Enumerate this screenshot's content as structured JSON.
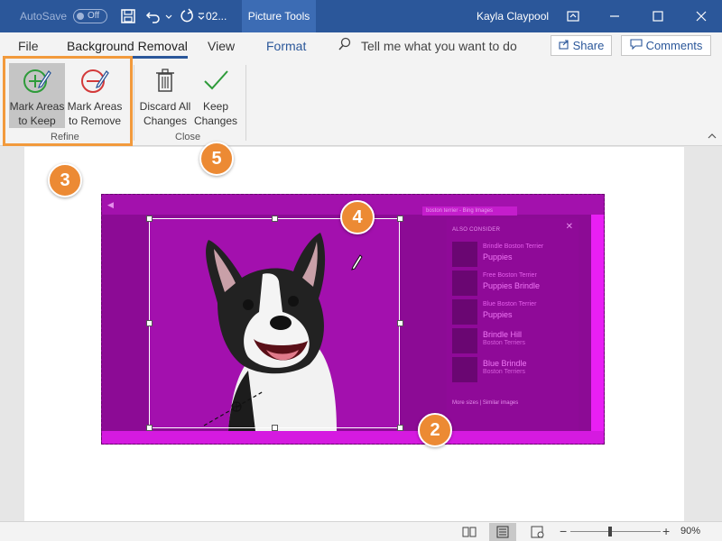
{
  "titlebar": {
    "autosave_label": "AutoSave",
    "autosave_state": "Off",
    "doc_name": "02...",
    "context_tab": "Picture Tools",
    "user": "Kayla Claypool",
    "accent": "#2b579a"
  },
  "tabs": {
    "file": "File",
    "background_removal": "Background Removal",
    "view": "View",
    "format": "Format",
    "tell_me": "Tell me what you want to do",
    "share": "Share",
    "comments": "Comments"
  },
  "ribbon": {
    "mark_keep_line1": "Mark Areas",
    "mark_keep_line2": "to Keep",
    "mark_remove_line1": "Mark Areas",
    "mark_remove_line2": "to Remove",
    "refine_group": "Refine",
    "discard_line1": "Discard All",
    "discard_line2": "Changes",
    "keep_line1": "Keep",
    "keep_line2": "Changes",
    "close_group": "Close"
  },
  "picture": {
    "browser_tab": "boston terrier - Bing Images",
    "panel_title": "ALSO CONSIDER",
    "items": [
      {
        "line1": "Brindle Boston Terrier",
        "line2": "Puppies"
      },
      {
        "line1": "Free Boston Terrier",
        "line2": "Puppies Brindle"
      },
      {
        "line1": "Blue Boston Terrier",
        "line2": "Puppies"
      },
      {
        "line1": "Brindle Hill",
        "line2": "Boston Terriers"
      },
      {
        "line1": "Blue Brindle",
        "line2": "Boston Terriers"
      }
    ],
    "panel_footer": "More sizes | Similar images",
    "removal_color": "#a310ae"
  },
  "callouts": {
    "c2": "2",
    "c3": "3",
    "c4": "4",
    "c5": "5",
    "color": "#ec8a34"
  },
  "statusbar": {
    "zoom_minus": "−",
    "zoom_plus": "+",
    "zoom": "90%",
    "zoom_level_percent": 90
  }
}
